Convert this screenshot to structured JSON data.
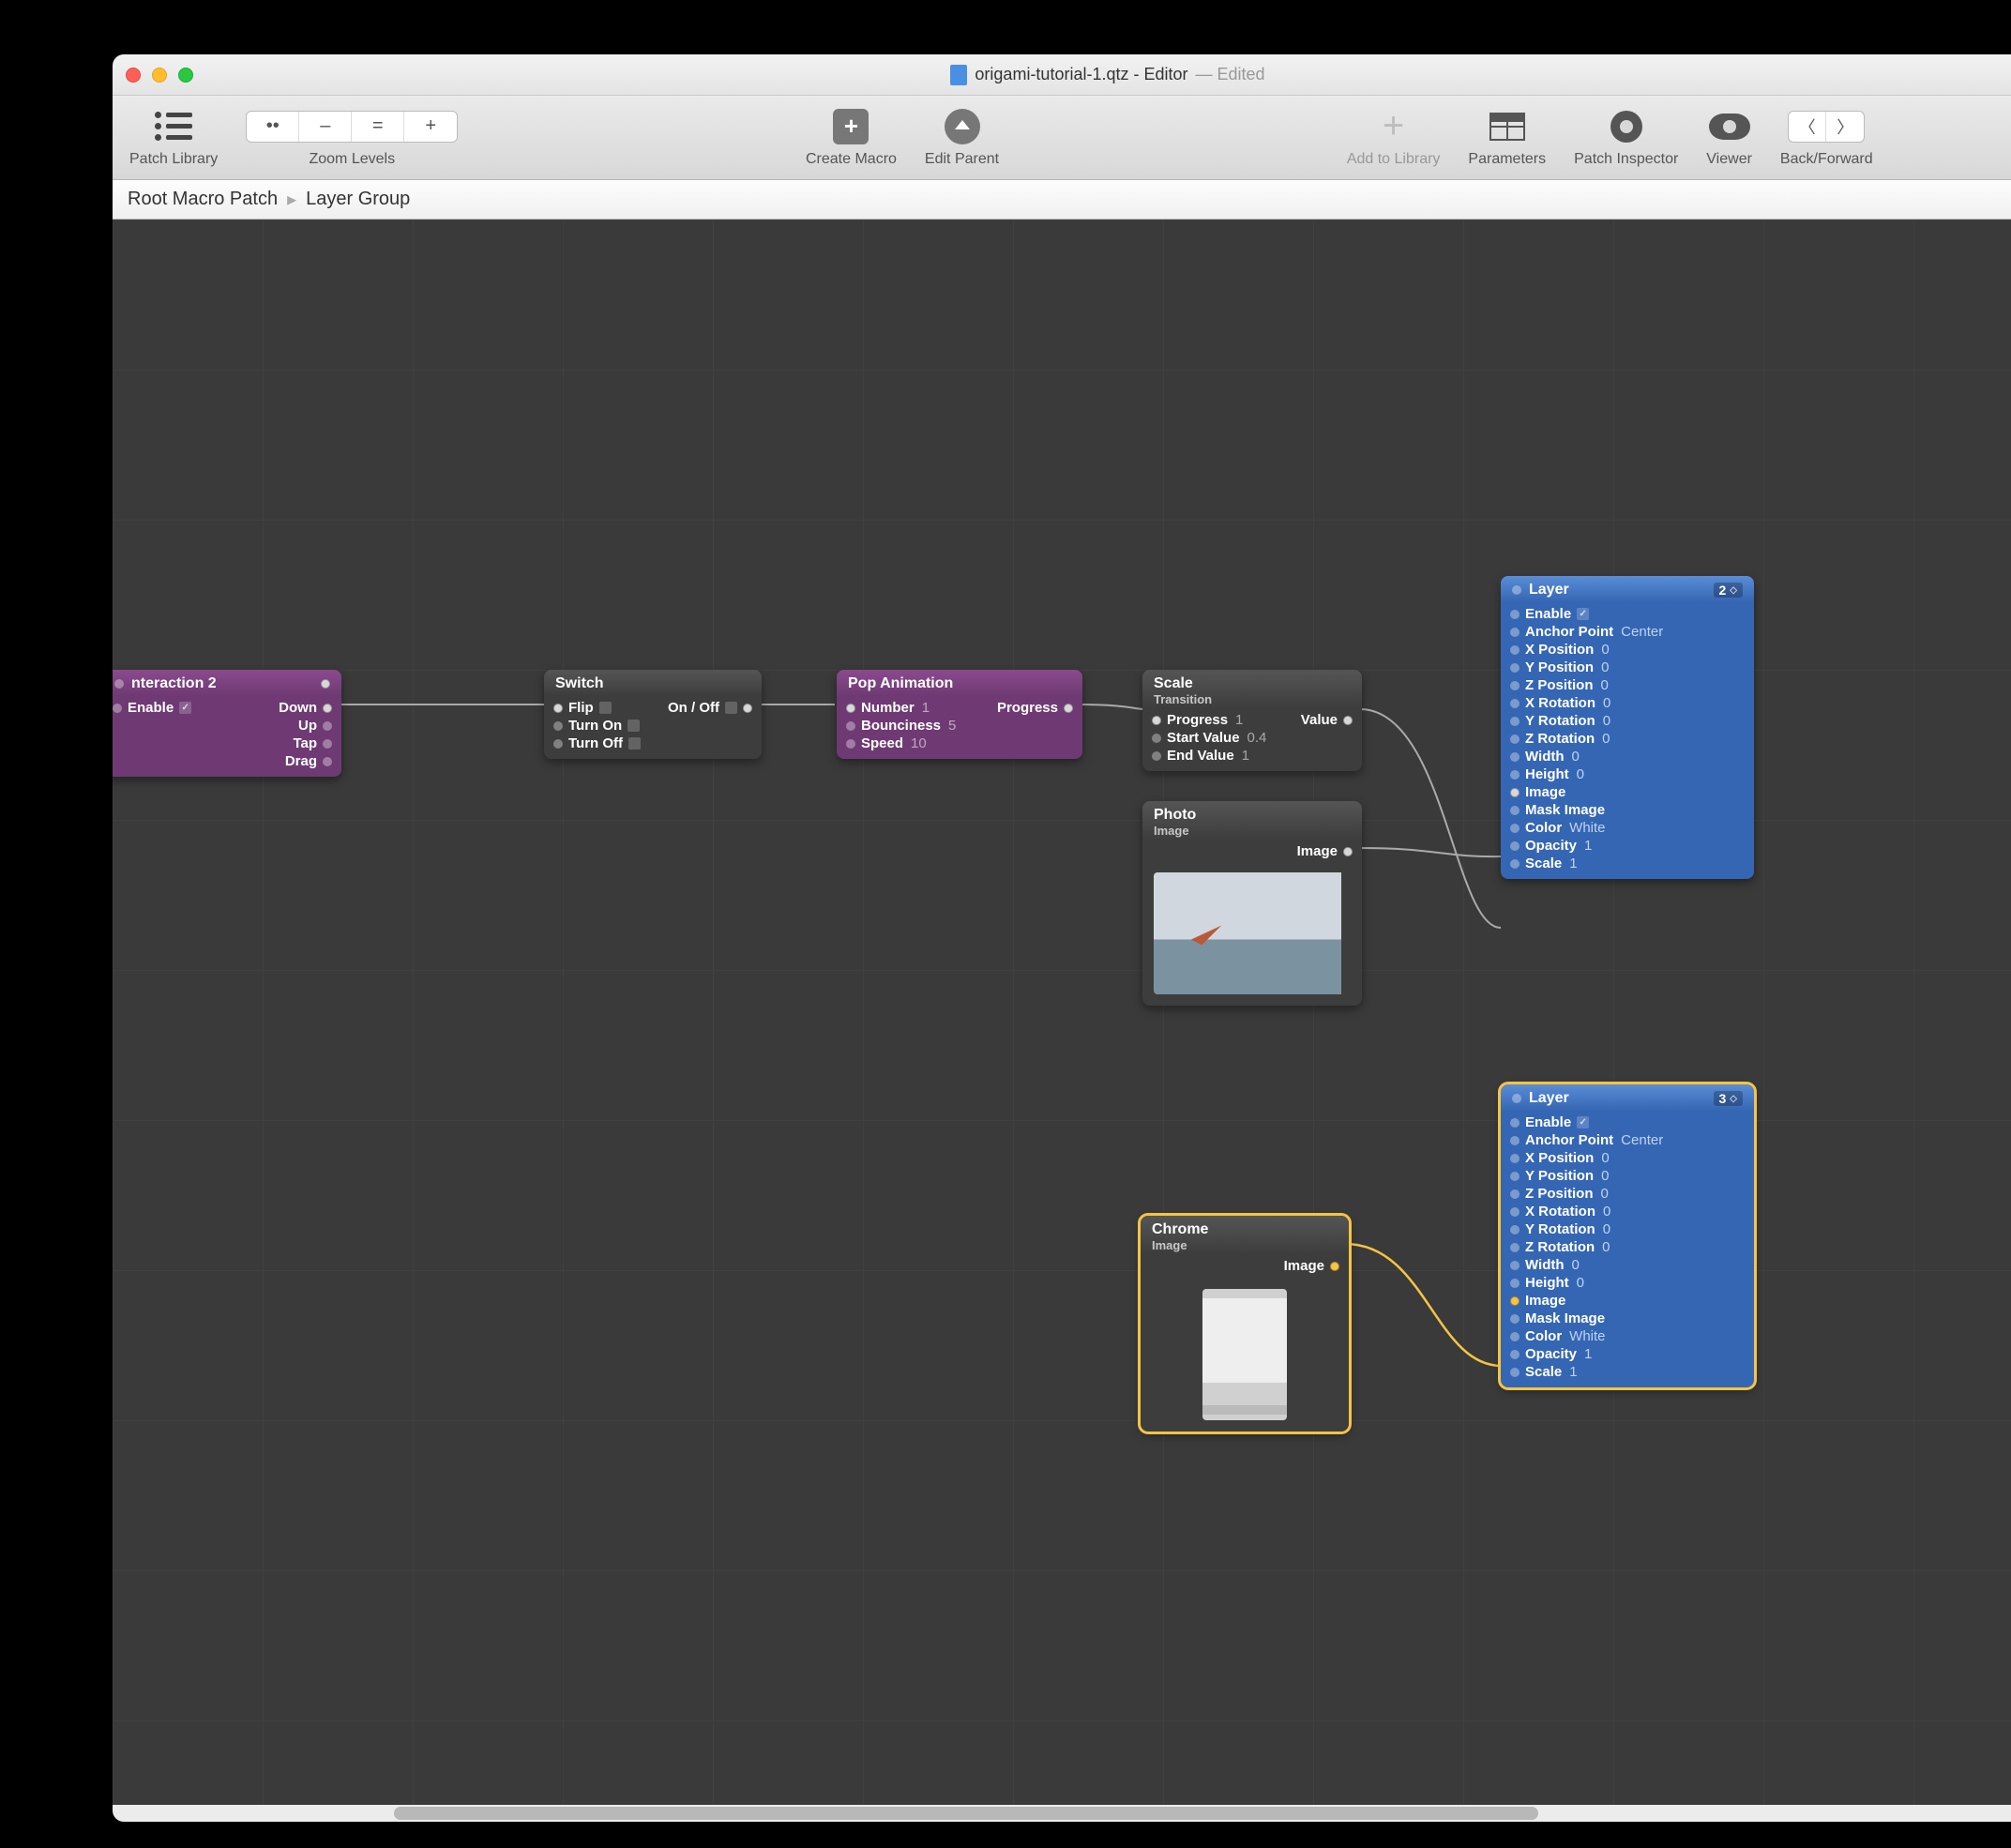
{
  "window": {
    "filename": "origami-tutorial-1.qtz",
    "role": "Editor",
    "edited": "Edited"
  },
  "toolbar": {
    "patchLibrary": "Patch Library",
    "zoomLevels": "Zoom Levels",
    "zoomButtons": [
      "••",
      "–",
      "=",
      "+"
    ],
    "createMacro": "Create Macro",
    "editParent": "Edit Parent",
    "addToLibrary": "Add to Library",
    "parameters": "Parameters",
    "patchInspector": "Patch Inspector",
    "viewer": "Viewer",
    "backForward": "Back/Forward"
  },
  "breadcrumb": {
    "root": "Root Macro Patch",
    "current": "Layer Group"
  },
  "nodes": {
    "interaction2": {
      "title": "nteraction 2",
      "inputs": [
        {
          "label": "Enable",
          "checked": true
        }
      ],
      "outputs": [
        "Down",
        "Up",
        "Tap",
        "Drag"
      ]
    },
    "switch": {
      "title": "Switch",
      "inputs": [
        {
          "label": "Flip",
          "box": true
        },
        {
          "label": "Turn On",
          "box": true
        },
        {
          "label": "Turn Off",
          "box": true
        }
      ],
      "outputs": [
        {
          "label": "On / Off",
          "box": true
        }
      ]
    },
    "pop": {
      "title": "Pop Animation",
      "inputs": [
        {
          "label": "Number",
          "val": "1"
        },
        {
          "label": "Bounciness",
          "val": "5"
        },
        {
          "label": "Speed",
          "val": "10"
        }
      ],
      "outputs": [
        {
          "label": "Progress"
        }
      ]
    },
    "scale": {
      "title": "Scale",
      "sub": "Transition",
      "inputs": [
        {
          "label": "Progress",
          "val": "1"
        },
        {
          "label": "Start Value",
          "val": "0.4"
        },
        {
          "label": "End Value",
          "val": "1"
        }
      ],
      "outputs": [
        {
          "label": "Value"
        }
      ]
    },
    "photo": {
      "title": "Photo",
      "sub": "Image",
      "outputs": [
        {
          "label": "Image"
        }
      ]
    },
    "chrome": {
      "title": "Chrome",
      "sub": "Image",
      "outputs": [
        {
          "label": "Image"
        }
      ]
    },
    "layer2": {
      "title": "Layer",
      "badge": "2",
      "inputs": [
        {
          "label": "Enable",
          "check": true
        },
        {
          "label": "Anchor Point",
          "val": "Center"
        },
        {
          "label": "X Position",
          "val": "0"
        },
        {
          "label": "Y Position",
          "val": "0"
        },
        {
          "label": "Z Position",
          "val": "0"
        },
        {
          "label": "X Rotation",
          "val": "0"
        },
        {
          "label": "Y Rotation",
          "val": "0"
        },
        {
          "label": "Z Rotation",
          "val": "0"
        },
        {
          "label": "Width",
          "val": "0"
        },
        {
          "label": "Height",
          "val": "0"
        },
        {
          "label": "Image",
          "connected": true
        },
        {
          "label": "Mask Image"
        },
        {
          "label": "Color",
          "val": "White"
        },
        {
          "label": "Opacity",
          "val": "1"
        },
        {
          "label": "Scale",
          "val": "1"
        }
      ]
    },
    "layer3": {
      "title": "Layer",
      "badge": "3",
      "inputs": [
        {
          "label": "Enable",
          "check": true
        },
        {
          "label": "Anchor Point",
          "val": "Center"
        },
        {
          "label": "X Position",
          "val": "0"
        },
        {
          "label": "Y Position",
          "val": "0"
        },
        {
          "label": "Z Position",
          "val": "0"
        },
        {
          "label": "X Rotation",
          "val": "0"
        },
        {
          "label": "Y Rotation",
          "val": "0"
        },
        {
          "label": "Z Rotation",
          "val": "0"
        },
        {
          "label": "Width",
          "val": "0"
        },
        {
          "label": "Height",
          "val": "0"
        },
        {
          "label": "Image",
          "connected": true
        },
        {
          "label": "Mask Image"
        },
        {
          "label": "Color",
          "val": "White"
        },
        {
          "label": "Opacity",
          "val": "1"
        },
        {
          "label": "Scale",
          "val": "1"
        }
      ]
    }
  }
}
